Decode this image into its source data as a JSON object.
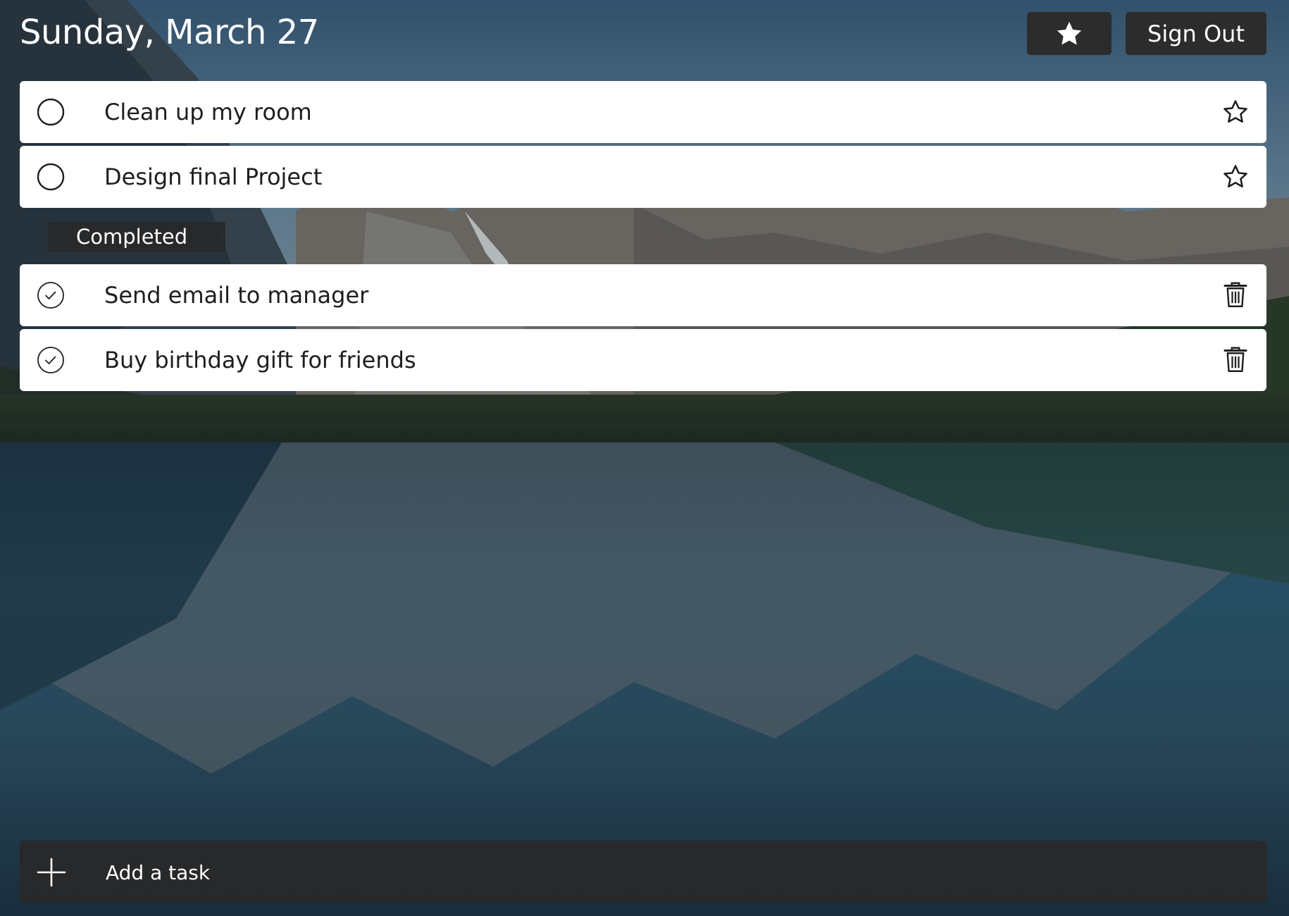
{
  "header": {
    "date": "Sunday, March 27",
    "favorites_icon": "star-filled-icon",
    "signout_label": "Sign Out"
  },
  "tasks": {
    "active": [
      {
        "title": "Clean up my room",
        "check_icon": "empty-circle-icon",
        "action_icon": "star-outline-icon"
      },
      {
        "title": "Design final Project",
        "check_icon": "empty-circle-icon",
        "action_icon": "star-outline-icon"
      }
    ],
    "completed_label": "Completed",
    "completed": [
      {
        "title": "Send email to manager",
        "check_icon": "check-circle-icon",
        "action_icon": "trash-icon"
      },
      {
        "title": "Buy birthday gift for friends",
        "check_icon": "check-circle-icon",
        "action_icon": "trash-icon"
      }
    ]
  },
  "add_task": {
    "placeholder": "Add a task",
    "icon": "plus-icon"
  },
  "colors": {
    "button_bg": "#2c2c2c",
    "card_bg": "#ffffff",
    "text_dark": "#1e1e1e",
    "text_light": "#ffffff"
  }
}
